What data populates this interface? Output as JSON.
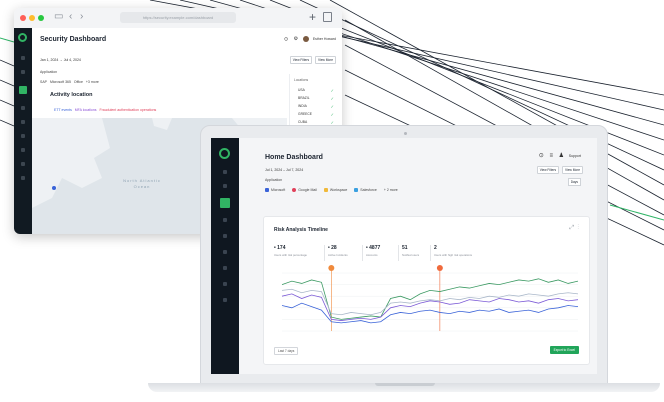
{
  "back_window": {
    "url": "https://security.example.com/dashboard",
    "title": "Security Dashboard",
    "user_name": "Esther Howard",
    "date_range": "Jan 1, 2024 → Jul 4, 2024",
    "application_label": "Application",
    "buttons": [
      "View Filters",
      "View More"
    ],
    "filters": [
      "SAP",
      "Microsoft 365",
      "Office",
      "+3 more"
    ],
    "activity_title": "Activity location",
    "activity_types": [
      "ETT events",
      "MFA locations",
      "Fraudulent authentication operations"
    ],
    "map_ocean_label": "North Atlantic Ocean",
    "locations_header": "Locations",
    "locations": [
      "USA",
      "BRAZIL",
      "INDIA",
      "GREECE",
      "CUBA"
    ]
  },
  "screen": {
    "title": "Home Dashboard",
    "date_range": "Jul 1, 2024 – Jul 7, 2024",
    "application_label": "Application",
    "filters": [
      "Microsoft",
      "Google Mail",
      "Workspace",
      "Salesforce",
      "+ 2 more"
    ],
    "user_label": "Support",
    "buttons": [
      "View Filters",
      "View More"
    ],
    "days_label": "Days",
    "card": {
      "title": "Risk Analysis Timeline",
      "stats": [
        {
          "value": "• 174",
          "label": "Users with risk percentage"
        },
        {
          "value": "• 28",
          "label": "Active Incidents"
        },
        {
          "value": "• 4877",
          "label": "Accounts"
        },
        {
          "value": "51",
          "label": "Notified users"
        },
        {
          "value": "2",
          "label": "Users with high risk operations"
        }
      ],
      "footer_select": "Last 7 days",
      "action_button": "Export to Excel"
    }
  },
  "chart_data": {
    "type": "line",
    "x": [
      0,
      1,
      2,
      3,
      4,
      5,
      6,
      7,
      8,
      9,
      10,
      11,
      12,
      13,
      14,
      15,
      16,
      17,
      18,
      19,
      20,
      21,
      22,
      23,
      24,
      25,
      26,
      27,
      28,
      29,
      30
    ],
    "series": [
      {
        "color": "#3c9a63",
        "values": [
          40,
          43,
          41,
          44,
          42,
          12,
          10,
          11,
          12,
          13,
          12,
          28,
          30,
          27,
          32,
          35,
          34,
          36,
          38,
          37,
          39,
          41,
          40,
          42,
          44,
          43,
          45,
          42,
          44,
          41,
          43
        ]
      },
      {
        "color": "#7c5bd6",
        "values": [
          30,
          32,
          28,
          31,
          29,
          10,
          9,
          10,
          11,
          10,
          12,
          20,
          22,
          21,
          24,
          26,
          25,
          23,
          24,
          27,
          26,
          25,
          28,
          27,
          25,
          26,
          24,
          27,
          28,
          26,
          27
        ]
      },
      {
        "color": "#3a63d8",
        "values": [
          22,
          20,
          24,
          21,
          18,
          8,
          7,
          8,
          9,
          7,
          8,
          14,
          16,
          15,
          17,
          18,
          16,
          15,
          17,
          16,
          18,
          17,
          19,
          16,
          17,
          18,
          16,
          19,
          20,
          22,
          21
        ]
      },
      {
        "color": "#a9b7c9",
        "values": [
          35,
          36,
          33,
          35,
          34,
          15,
          14,
          16,
          15,
          14,
          16,
          24,
          25,
          24,
          26,
          27,
          26,
          28,
          27,
          29,
          28,
          30,
          29,
          31,
          30,
          32,
          31,
          30,
          32,
          33,
          32
        ]
      }
    ],
    "markers": [
      {
        "x": 5,
        "color": "#f08a3c"
      },
      {
        "x": 16,
        "color": "#f06a3c"
      }
    ],
    "ylim": [
      0,
      50
    ]
  }
}
